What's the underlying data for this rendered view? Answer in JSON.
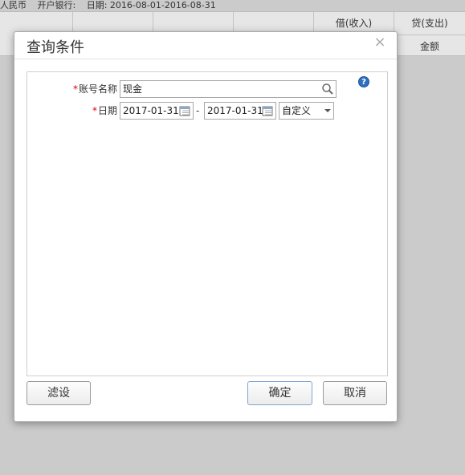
{
  "background": {
    "info_currency": "人民币",
    "info_bank_label": "开户银行:",
    "info_date": "日期: 2016-08-01-2016-08-31",
    "col_debit": "借(收入)",
    "col_credit": "贷(支出)",
    "col_amount": "金额"
  },
  "dialog": {
    "title": "查询条件",
    "close": "×",
    "help": "?",
    "account_label": "账号名称",
    "account_value": "现金",
    "date_label": "日期",
    "date_from": "2017-01-31",
    "date_separator": "-",
    "date_to": "2017-01-31",
    "period_select": "自定义",
    "filter_button": "滤设",
    "ok_button": "确定",
    "cancel_button": "取消"
  }
}
